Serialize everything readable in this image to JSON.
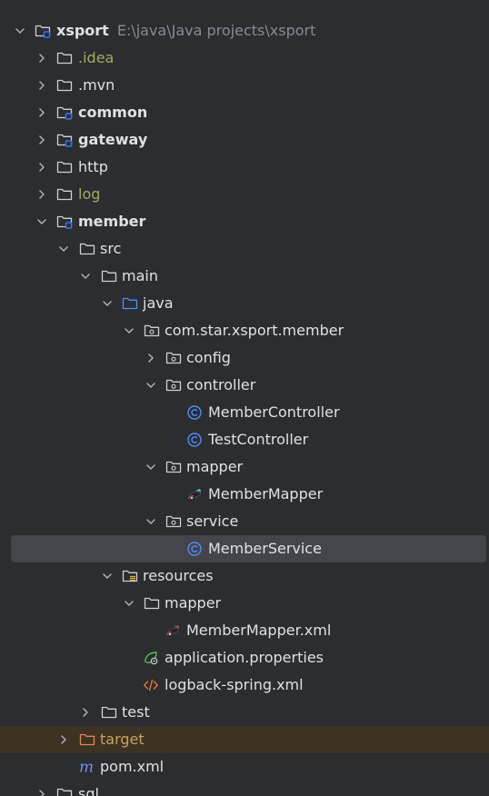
{
  "tree": {
    "root": {
      "name": "xsport",
      "path": "E:\\java\\Java projects\\xsport"
    },
    "idea": ".idea",
    "mvn": ".mvn",
    "common": "common",
    "gateway": "gateway",
    "http": "http",
    "log": "log",
    "member": "member",
    "src": "src",
    "main": "main",
    "java": "java",
    "package": "com.star.xsport.member",
    "config": "config",
    "controller": "controller",
    "member_controller": "MemberController",
    "test_controller": "TestController",
    "mapper_pkg": "mapper",
    "member_mapper": "MemberMapper",
    "service": "service",
    "member_service": "MemberService",
    "resources": "resources",
    "mapper_dir": "mapper",
    "member_mapper_xml": "MemberMapper.xml",
    "app_props": "application.properties",
    "logback": "logback-spring.xml",
    "test": "test",
    "target": "target",
    "pom": "pom.xml",
    "sql": "sql"
  },
  "colors": {
    "background": "#2b2d30",
    "selection": "#43454a",
    "excluded_bg": "#3d3223",
    "text": "#dfe1e5",
    "muted": "#868a91",
    "ignored_text": "#a4ab5b",
    "excluded_text": "#c7a25f",
    "class_icon": "#548af7",
    "module_badge": "#3574f0"
  },
  "icons": {
    "expanded": "chevron-down-icon",
    "collapsed": "chevron-right-icon",
    "folder": "folder-icon",
    "module": "module-folder-icon",
    "package": "package-icon",
    "source_root": "source-root-icon",
    "resources_root": "resources-root-icon",
    "class": "class-icon",
    "mybatis": "mybatis-mapper-icon",
    "spring": "spring-properties-icon",
    "xml": "xml-file-icon",
    "maven": "maven-pom-icon"
  }
}
